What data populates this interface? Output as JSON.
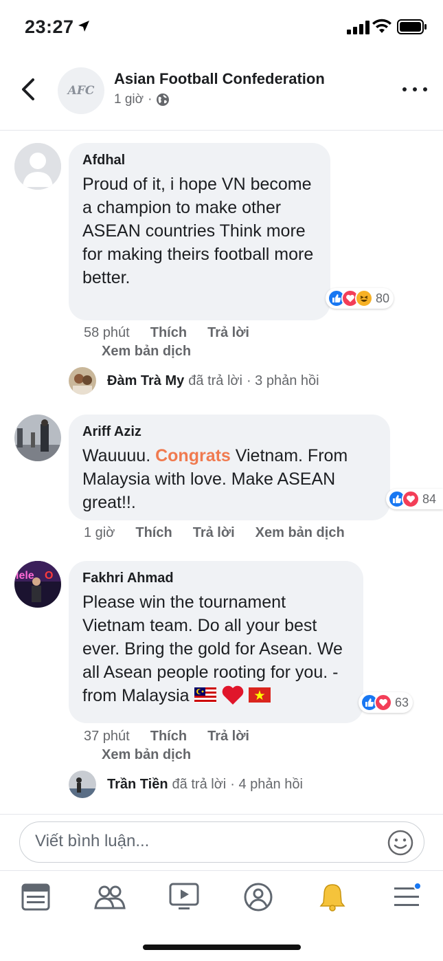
{
  "status_bar": {
    "time": "23:27"
  },
  "header": {
    "page_name": "Asian Football Confederation",
    "avatar_text": "AFC",
    "post_time": "1 giờ",
    "separator": "·"
  },
  "comments": [
    {
      "author": "Afdhal",
      "text": "Proud of it, i hope VN become a champion to make other ASEAN countries Think more for making theirs football more better.",
      "reaction_count": "80",
      "reactions": [
        "like-icon",
        "love-icon",
        "haha-icon"
      ],
      "time": "58 phút",
      "like_label": "Thích",
      "reply_label": "Trả lời",
      "translate_label": "Xem bản dịch",
      "reply_summary": {
        "name": "Đàm Trà My",
        "action": "đã trả lời",
        "count": "· 3 phản hồi"
      }
    },
    {
      "author": "Ariff Aziz",
      "text_before": "Wauuuu.",
      "text_highlight": "Congrats",
      "text_after": "Vietnam. From Malaysia with love. Make ASEAN great!!.",
      "reaction_count": "84",
      "reactions": [
        "like-icon",
        "love-icon"
      ],
      "time": "1 giờ",
      "like_label": "Thích",
      "reply_label": "Trả lời",
      "translate_label": "Xem bản dịch"
    },
    {
      "author": "Fakhri Ahmad",
      "text": "Please win the tournament Vietnam team. Do all your best ever. Bring the gold for Asean. We all Asean people rooting for you. - from Malaysia",
      "emoji": [
        "malaysia-flag-icon",
        "red-heart-icon",
        "vietnam-flag-icon"
      ],
      "reaction_count": "63",
      "reactions": [
        "like-icon",
        "love-icon"
      ],
      "time": "37 phút",
      "like_label": "Thích",
      "reply_label": "Trả lời",
      "translate_label": "Xem bản dịch",
      "reply_summary": {
        "name": "Trần Tiền",
        "action": "đã trả lời",
        "count": "· 4 phản hồi"
      }
    }
  ],
  "composer": {
    "placeholder": "Viết bình luận..."
  },
  "tabbar": {
    "tabs": [
      "news-feed-icon",
      "friends-icon",
      "watch-icon",
      "profile-icon",
      "notifications-icon",
      "menu-icon"
    ]
  },
  "colors": {
    "accent": "#1877f2",
    "love": "#f33e58",
    "highlight": "#f07a4f",
    "bubble": "#f0f2f5",
    "muted": "#65676b"
  }
}
